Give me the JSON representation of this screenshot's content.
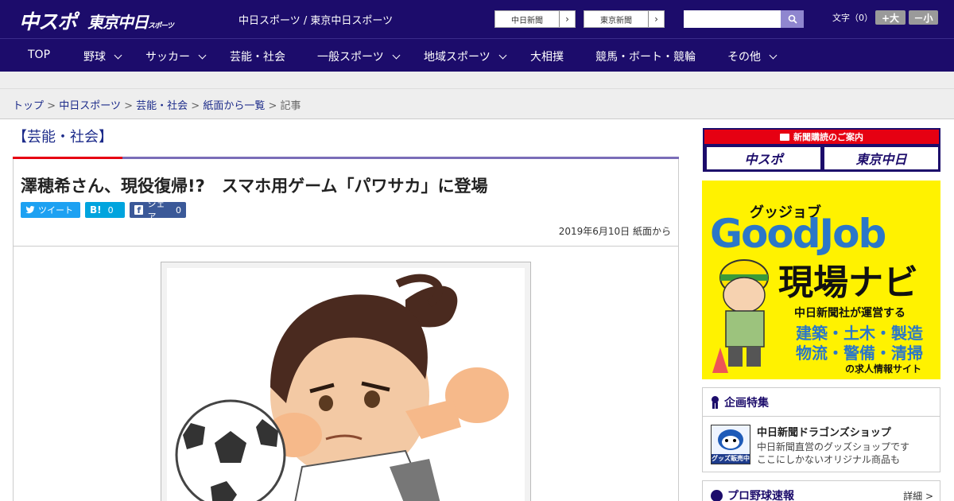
{
  "header": {
    "logo_chuspo": "中スポ",
    "logo_tokyo": "東京中日",
    "logo_tokyo_small": "スポーツ",
    "site_links": "中日スポーツ / 東京中日スポーツ",
    "paper_buttons": [
      "中日新聞",
      "東京新聞"
    ],
    "search_placeholder": "",
    "font_size_label": "文字（0）",
    "font_larger": "+大",
    "font_smaller": "－小"
  },
  "nav": {
    "items": [
      "TOP",
      "野球",
      "サッカー",
      "芸能・社会",
      "一般スポーツ",
      "地域スポーツ",
      "大相撲",
      "競馬・ボート・競輪",
      "その他"
    ]
  },
  "breadcrumb": {
    "items": [
      "トップ",
      "中日スポーツ",
      "芸能・社会",
      "紙面から一覧"
    ],
    "current": "記事",
    "separator": ">"
  },
  "article": {
    "category": "【芸能・社会】",
    "title": "澤穂希さん、現役復帰!?　スマホ用ゲーム「パワサカ」に登場",
    "share": {
      "tweet": "ツイート",
      "hatena_label": "B!",
      "hatena_count": "0",
      "fb_label": "シェア",
      "fb_count": "0"
    },
    "date": "2019年6月10日 紙面から"
  },
  "sidebar": {
    "subscription": {
      "title": "新聞購読のご案内",
      "buttons": [
        "中スポ",
        "東京中日"
      ]
    },
    "goodjob": {
      "kana": "グッジョブ",
      "main": "GoodJob",
      "navi": "現場ナビ",
      "operator": "中日新聞社が運営する",
      "jobs1": "建築・土木・製造",
      "jobs2": "物流・警備・清掃",
      "footer": "の求人情報サイト"
    },
    "feature": {
      "title": "企画特集",
      "item_title": "中日新聞ドラゴンズショップ",
      "item_desc1": "中日新聞直営のグッズショップです",
      "item_desc2": "ここにしかないオリジナル商品も",
      "thumb_label": "グッズ販売中"
    },
    "baseball": {
      "title": "プロ野球速報",
      "detail": "詳細 >"
    }
  },
  "colors": {
    "brand": "#1c0c6b",
    "accent": "#e60012",
    "link": "#1c2b8a",
    "twitter": "#1da1f2",
    "hatena": "#00a4de",
    "facebook": "#3b5998"
  }
}
